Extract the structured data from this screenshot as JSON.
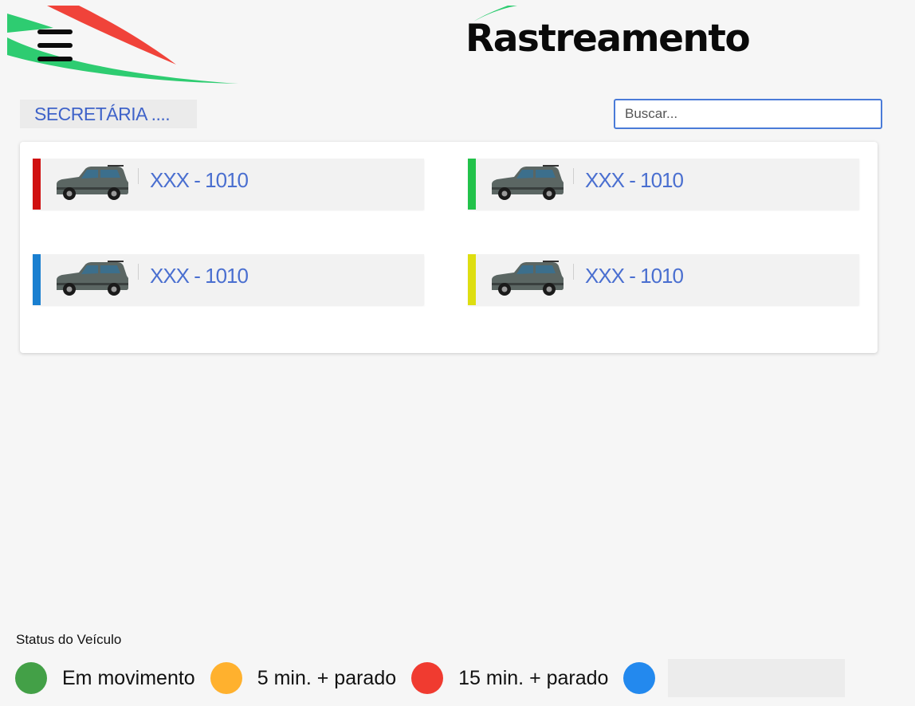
{
  "header": {
    "title": "Rastreamento",
    "menu_icon": "hamburger-menu-icon"
  },
  "filter": {
    "department": "SECRETÁRIA ...."
  },
  "search": {
    "placeholder": "Buscar...",
    "value": ""
  },
  "vehicles": [
    {
      "plate": "XXX - 1010",
      "status_color": "#d01010",
      "icon": "car-icon"
    },
    {
      "plate": "XXX - 1010",
      "status_color": "#22c24a",
      "icon": "car-icon"
    },
    {
      "plate": "XXX - 1010",
      "status_color": "#1a7fd0",
      "icon": "car-icon"
    },
    {
      "plate": "XXX - 1010",
      "status_color": "#dede10",
      "icon": "car-icon"
    }
  ],
  "legend": {
    "title": "Status do Veículo",
    "items": [
      {
        "label": "Em movimento",
        "color": "#43a047"
      },
      {
        "label": "5 min. + parado",
        "color": "#ffb12e"
      },
      {
        "label": "15 min. + parado",
        "color": "#f03b30"
      },
      {
        "label": "",
        "color": "#2389ee"
      }
    ]
  }
}
